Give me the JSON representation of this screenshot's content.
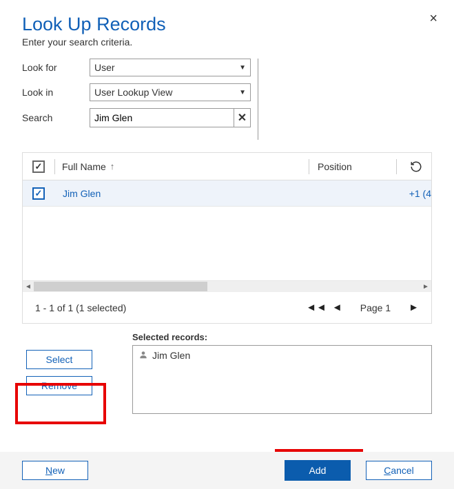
{
  "dialog": {
    "title": "Look Up Records",
    "subtitle": "Enter your search criteria."
  },
  "fields": {
    "lookfor_label": "Look for",
    "lookfor_value": "User",
    "lookin_label": "Look in",
    "lookin_value": "User Lookup View",
    "search_label": "Search",
    "search_value": "Jim Glen"
  },
  "grid": {
    "columns": {
      "fullname": "Full Name",
      "position": "Position"
    },
    "rows": [
      {
        "name": "Jim Glen",
        "phone_partial": "+1 (4"
      }
    ],
    "status": "1 - 1 of 1 (1 selected)",
    "page_label": "Page 1"
  },
  "selected": {
    "label": "Selected records:",
    "items": [
      "Jim Glen"
    ]
  },
  "buttons": {
    "select": "Select",
    "remove": "Remove",
    "new_prefix": "N",
    "new_rest": "ew",
    "add": "Add",
    "cancel_prefix": "C",
    "cancel_rest": "ancel"
  }
}
